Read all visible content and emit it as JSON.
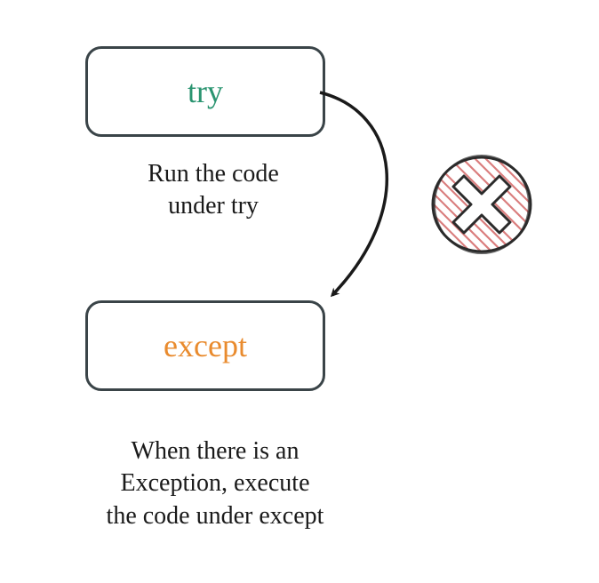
{
  "boxes": {
    "try": {
      "label": "try"
    },
    "except": {
      "label": "except"
    }
  },
  "captions": {
    "try": "Run the code\nunder try",
    "except": "When there is an\nException, execute\nthe code under except"
  },
  "icons": {
    "error": "cross-mark-icon"
  },
  "colors": {
    "try": "#2a9470",
    "except": "#e98b2e",
    "boxBorder": "#3a4448",
    "text": "#1a1a1a",
    "errorFill": "#e8a0a0",
    "errorStroke": "#3a3a3a"
  }
}
